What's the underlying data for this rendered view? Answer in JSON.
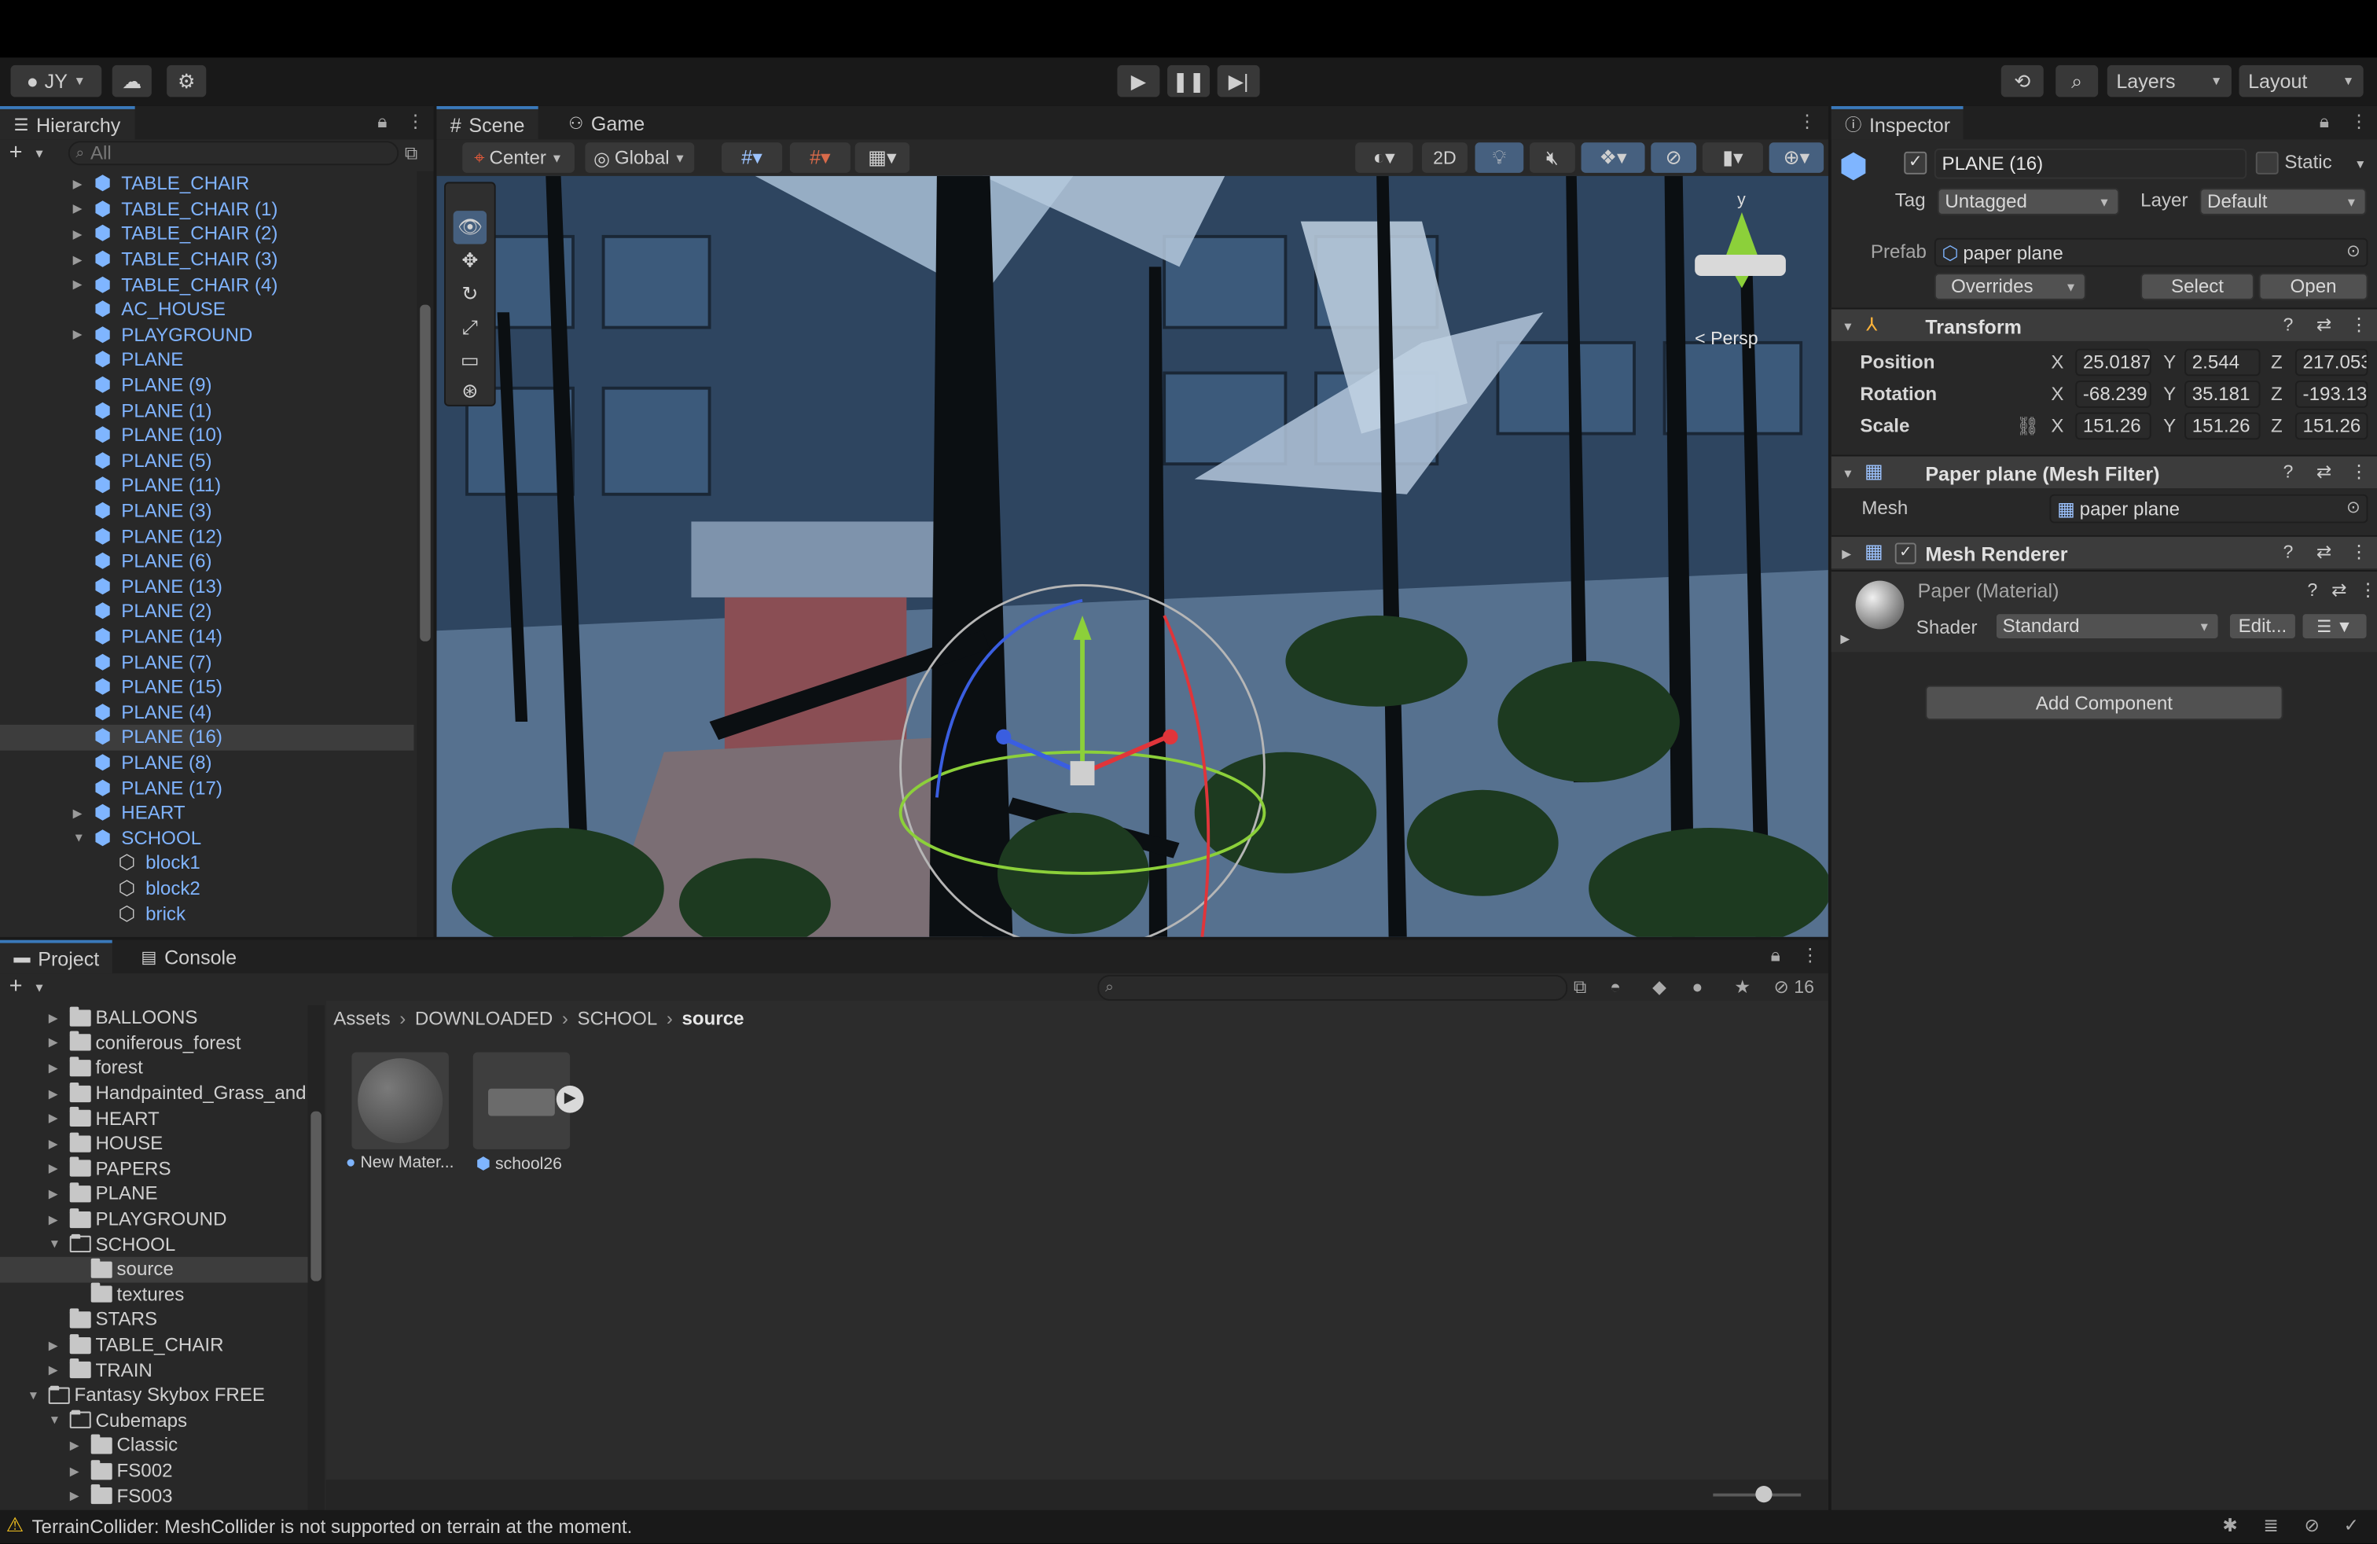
{
  "account": {
    "label": "JY"
  },
  "toolbar": {
    "layers": "Layers",
    "layout": "Layout"
  },
  "hierarchy": {
    "title": "Hierarchy",
    "search_placeholder": "All",
    "items": [
      {
        "label": "TABLE_CHAIR",
        "indent": 1,
        "arrow": "right",
        "icon": "prefab",
        "selected": false
      },
      {
        "label": "TABLE_CHAIR (1)",
        "indent": 1,
        "arrow": "right",
        "icon": "prefab",
        "selected": false
      },
      {
        "label": "TABLE_CHAIR (2)",
        "indent": 1,
        "arrow": "right",
        "icon": "prefab",
        "selected": false
      },
      {
        "label": "TABLE_CHAIR (3)",
        "indent": 1,
        "arrow": "right",
        "icon": "prefab",
        "selected": false
      },
      {
        "label": "TABLE_CHAIR (4)",
        "indent": 1,
        "arrow": "right",
        "icon": "prefab",
        "selected": false
      },
      {
        "label": "AC_HOUSE",
        "indent": 1,
        "arrow": "",
        "icon": "prefab",
        "selected": false
      },
      {
        "label": "PLAYGROUND",
        "indent": 1,
        "arrow": "right",
        "icon": "prefab",
        "selected": false
      },
      {
        "label": "PLANE",
        "indent": 1,
        "arrow": "",
        "icon": "prefab",
        "selected": false
      },
      {
        "label": "PLANE (9)",
        "indent": 1,
        "arrow": "",
        "icon": "prefab",
        "selected": false
      },
      {
        "label": "PLANE (1)",
        "indent": 1,
        "arrow": "",
        "icon": "prefab",
        "selected": false
      },
      {
        "label": "PLANE (10)",
        "indent": 1,
        "arrow": "",
        "icon": "prefab",
        "selected": false
      },
      {
        "label": "PLANE (5)",
        "indent": 1,
        "arrow": "",
        "icon": "prefab",
        "selected": false
      },
      {
        "label": "PLANE (11)",
        "indent": 1,
        "arrow": "",
        "icon": "prefab",
        "selected": false
      },
      {
        "label": "PLANE (3)",
        "indent": 1,
        "arrow": "",
        "icon": "prefab",
        "selected": false
      },
      {
        "label": "PLANE (12)",
        "indent": 1,
        "arrow": "",
        "icon": "prefab",
        "selected": false
      },
      {
        "label": "PLANE (6)",
        "indent": 1,
        "arrow": "",
        "icon": "prefab",
        "selected": false
      },
      {
        "label": "PLANE (13)",
        "indent": 1,
        "arrow": "",
        "icon": "prefab",
        "selected": false
      },
      {
        "label": "PLANE (2)",
        "indent": 1,
        "arrow": "",
        "icon": "prefab",
        "selected": false
      },
      {
        "label": "PLANE (14)",
        "indent": 1,
        "arrow": "",
        "icon": "prefab",
        "selected": false
      },
      {
        "label": "PLANE (7)",
        "indent": 1,
        "arrow": "",
        "icon": "prefab",
        "selected": false
      },
      {
        "label": "PLANE (15)",
        "indent": 1,
        "arrow": "",
        "icon": "prefab",
        "selected": false
      },
      {
        "label": "PLANE (4)",
        "indent": 1,
        "arrow": "",
        "icon": "prefab",
        "selected": false
      },
      {
        "label": "PLANE (16)",
        "indent": 1,
        "arrow": "",
        "icon": "prefab",
        "selected": true
      },
      {
        "label": "PLANE (8)",
        "indent": 1,
        "arrow": "",
        "icon": "prefab",
        "selected": false
      },
      {
        "label": "PLANE (17)",
        "indent": 1,
        "arrow": "",
        "icon": "prefab",
        "selected": false
      },
      {
        "label": "HEART",
        "indent": 1,
        "arrow": "right",
        "icon": "prefab",
        "selected": false
      },
      {
        "label": "SCHOOL",
        "indent": 1,
        "arrow": "down",
        "icon": "prefab",
        "selected": false
      },
      {
        "label": "block1",
        "indent": 2,
        "arrow": "",
        "icon": "mesh",
        "selected": false
      },
      {
        "label": "block2",
        "indent": 2,
        "arrow": "",
        "icon": "mesh",
        "selected": false
      },
      {
        "label": "brick",
        "indent": 2,
        "arrow": "",
        "icon": "mesh",
        "selected": false
      }
    ]
  },
  "scene": {
    "tabs": [
      {
        "label": "Scene",
        "icon": "hash-icon"
      },
      {
        "label": "Game",
        "icon": "gamepad-icon"
      }
    ],
    "pivot": "Center",
    "space": "Global",
    "mode_2d": "2D",
    "persp": "Persp",
    "gizmo_y": "y"
  },
  "inspector": {
    "title": "Inspector",
    "object_name": "PLANE (16)",
    "static_label": "Static",
    "tag_label": "Tag",
    "tag_value": "Untagged",
    "layer_label": "Layer",
    "layer_value": "Default",
    "prefab_label": "Prefab",
    "prefab_value": "paper plane",
    "overrides": "Overrides",
    "select": "Select",
    "open": "Open",
    "transform": {
      "title": "Transform",
      "rows": [
        {
          "label": "Position",
          "x": "25.0187",
          "y": "2.544",
          "z": "217.053"
        },
        {
          "label": "Rotation",
          "x": "-68.239",
          "y": "35.181",
          "z": "-193.13"
        },
        {
          "label": "Scale",
          "x": "151.26",
          "y": "151.26",
          "z": "151.26"
        }
      ]
    },
    "mesh_filter": {
      "title": "Paper plane  (Mesh Filter)",
      "mesh_label": "Mesh",
      "mesh_value": "paper plane"
    },
    "mesh_renderer": {
      "title": "Mesh Renderer"
    },
    "material": {
      "title": "Paper (Material)",
      "shader_label": "Shader",
      "shader_value": "Standard",
      "edit": "Edit..."
    },
    "add_component": "Add Component"
  },
  "project": {
    "tabs": [
      "Project",
      "Console"
    ],
    "hidden_count": "16",
    "breadcrumb": [
      "Assets",
      "DOWNLOADED",
      "SCHOOL",
      "source"
    ],
    "folders": [
      {
        "label": "BALLOONS",
        "level": 2,
        "arrow": "right",
        "open": false,
        "selected": false
      },
      {
        "label": "coniferous_forest",
        "level": 2,
        "arrow": "right",
        "open": false,
        "selected": false
      },
      {
        "label": "forest",
        "level": 2,
        "arrow": "right",
        "open": false,
        "selected": false
      },
      {
        "label": "Handpainted_Grass_and",
        "level": 2,
        "arrow": "right",
        "open": false,
        "selected": false
      },
      {
        "label": "HEART",
        "level": 2,
        "arrow": "right",
        "open": false,
        "selected": false
      },
      {
        "label": "HOUSE",
        "level": 2,
        "arrow": "right",
        "open": false,
        "selected": false
      },
      {
        "label": "PAPERS",
        "level": 2,
        "arrow": "right",
        "open": false,
        "selected": false
      },
      {
        "label": "PLANE",
        "level": 2,
        "arrow": "right",
        "open": false,
        "selected": false
      },
      {
        "label": "PLAYGROUND",
        "level": 2,
        "arrow": "right",
        "open": false,
        "selected": false
      },
      {
        "label": "SCHOOL",
        "level": 2,
        "arrow": "down",
        "open": true,
        "selected": false
      },
      {
        "label": "source",
        "level": 3,
        "arrow": "",
        "open": false,
        "selected": true
      },
      {
        "label": "textures",
        "level": 3,
        "arrow": "",
        "open": false,
        "selected": false
      },
      {
        "label": "STARS",
        "level": 2,
        "arrow": "",
        "open": false,
        "selected": false
      },
      {
        "label": "TABLE_CHAIR",
        "level": 2,
        "arrow": "right",
        "open": false,
        "selected": false
      },
      {
        "label": "TRAIN",
        "level": 2,
        "arrow": "right",
        "open": false,
        "selected": false
      },
      {
        "label": "Fantasy Skybox FREE",
        "level": 1,
        "arrow": "down",
        "open": true,
        "selected": false
      },
      {
        "label": "Cubemaps",
        "level": 2,
        "arrow": "down",
        "open": true,
        "selected": false
      },
      {
        "label": "Classic",
        "level": 3,
        "arrow": "right",
        "open": false,
        "selected": false
      },
      {
        "label": "FS002",
        "level": 3,
        "arrow": "right",
        "open": false,
        "selected": false
      },
      {
        "label": "FS003",
        "level": 3,
        "arrow": "right",
        "open": false,
        "selected": false
      }
    ],
    "assets": [
      {
        "label": "New Mater...",
        "kind": "material"
      },
      {
        "label": "school26",
        "kind": "model"
      }
    ]
  },
  "status": {
    "message": "TerrainCollider: MeshCollider is not supported on terrain at the moment."
  }
}
